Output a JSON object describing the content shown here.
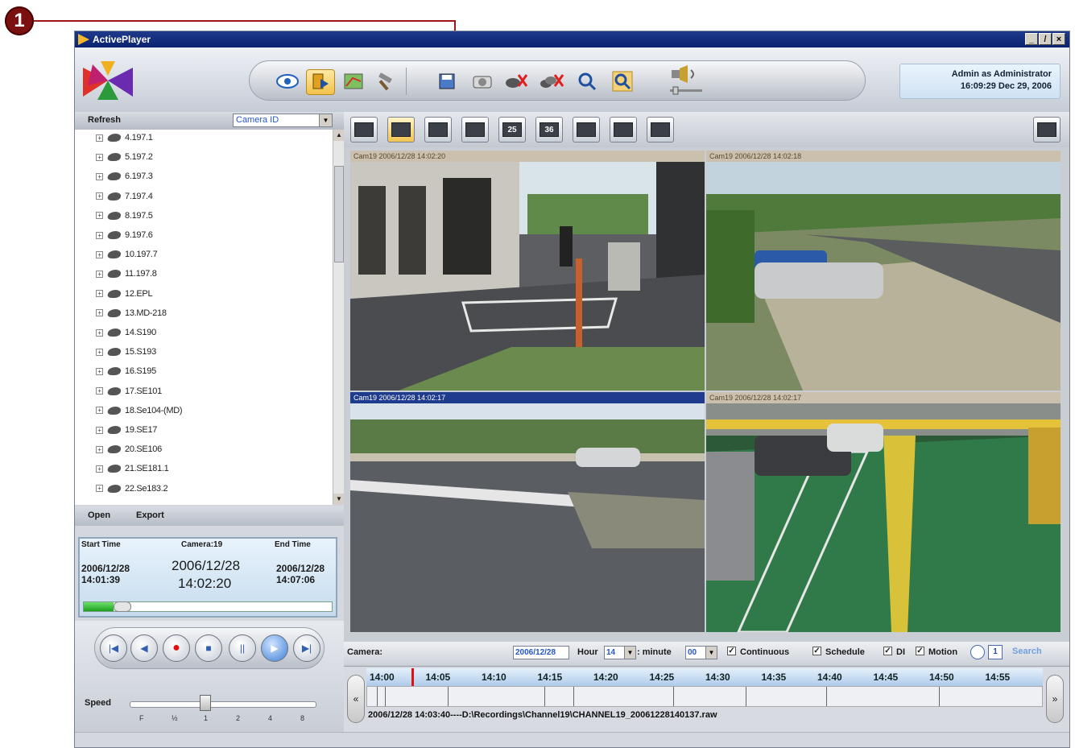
{
  "callout": {
    "number": "1"
  },
  "window": {
    "title": "ActivePlayer",
    "controls": [
      "_",
      "̸",
      "×"
    ]
  },
  "toolbar": {
    "buttons": [
      {
        "name": "live-view",
        "icon": "eye-icon"
      },
      {
        "name": "playback",
        "icon": "playback-icon",
        "active": true
      },
      {
        "name": "map",
        "icon": "map-icon"
      },
      {
        "name": "settings",
        "icon": "tools-icon"
      },
      {
        "name": "save-image",
        "icon": "floppy-icon"
      },
      {
        "name": "snapshot",
        "icon": "camera-icon"
      },
      {
        "name": "disconnect",
        "icon": "disconnect-icon"
      },
      {
        "name": "disconnect-all",
        "icon": "disconnect-all-icon"
      },
      {
        "name": "zoom-in",
        "icon": "magnifier-icon"
      },
      {
        "name": "zoom-reset",
        "icon": "magnifier-reset-icon"
      },
      {
        "name": "volume",
        "icon": "speaker-icon"
      }
    ]
  },
  "user": {
    "line1": "Admin as Administrator",
    "line2": "16:09:29 Dec 29, 2006"
  },
  "left": {
    "refresh": "Refresh",
    "sort_select": "Camera ID",
    "cameras": [
      "4.197.1",
      "5.197.2",
      "6.197.3",
      "7.197.4",
      "8.197.5",
      "9.197.6",
      "10.197.7",
      "11.197.8",
      "12.EPL",
      "13.MD-218",
      "14.S190",
      "15.S193",
      "16.S195",
      "17.SE101",
      "18.Se104-(MD)",
      "19.SE17",
      "20.SE106",
      "21.SE181.1",
      "22.Se183.2"
    ],
    "open": "Open",
    "export": "Export"
  },
  "time": {
    "start_label": "Start Time",
    "camera_label": "Camera:19",
    "end_label": "End Time",
    "start_date": "2006/12/28",
    "start_time": "14:01:39",
    "cur_date": "2006/12/28",
    "cur_time": "14:02:20",
    "end_date": "2006/12/28",
    "end_time": "14:07:06",
    "progress": 0.12
  },
  "playback": {
    "buttons": [
      "skip-start",
      "rewind",
      "record",
      "stop",
      "pause",
      "play",
      "skip-end"
    ],
    "speed_label": "Speed",
    "speed_ticks": [
      "F",
      "½",
      "1",
      "2",
      "4",
      "8"
    ],
    "speed_value": "1"
  },
  "layouts": [
    "1",
    "4",
    "9",
    "16",
    "25",
    "36",
    "layout-a",
    "layout-b",
    "layout-c"
  ],
  "cams": [
    {
      "header": "Cam19 2006/12/28 14:02:20",
      "selected": false
    },
    {
      "header": "Cam19 2006/12/28 14:02:18",
      "selected": false
    },
    {
      "header": "Cam19 2006/12/28 14:02:17",
      "selected": true
    },
    {
      "header": "Cam19 2006/12/28 14:02:17",
      "selected": false
    }
  ],
  "search": {
    "camera_label": "Camera:",
    "date": "2006/12/28",
    "hour_label": "Hour",
    "hour": "14",
    "minute_label": ": minute",
    "minute": "00",
    "continuous": "Continuous",
    "schedule": "Schedule",
    "di": "DI",
    "motion": "Motion",
    "search": "Search"
  },
  "timeline": {
    "labels": [
      "14:00",
      "14:05",
      "14:10",
      "14:15",
      "14:20",
      "14:25",
      "14:30",
      "14:35",
      "14:40",
      "14:45",
      "14:50",
      "14:55"
    ],
    "file": "2006/12/28 14:03:40----D:\\Recordings\\Channel19\\CHANNEL19_20061228140137.raw"
  }
}
